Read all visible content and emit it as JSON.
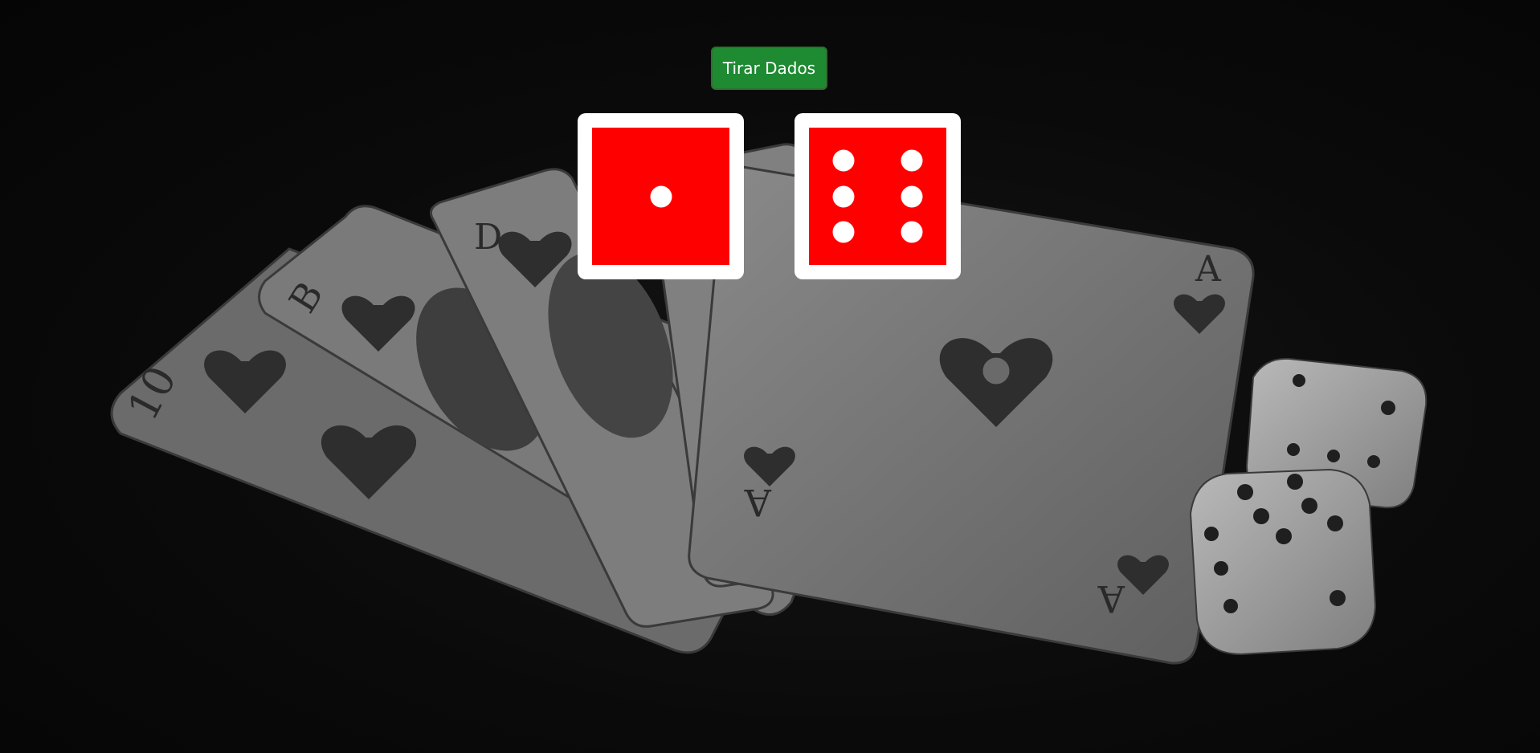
{
  "controls": {
    "roll_button_label": "Tirar Dados"
  },
  "dice": [
    {
      "value": 1,
      "face_color": "#ff0000",
      "border_color": "#ffffff",
      "pip_color": "#ffffff"
    },
    {
      "value": 6,
      "face_color": "#ff0000",
      "border_color": "#ffffff",
      "pip_color": "#ffffff"
    }
  ],
  "colors": {
    "button_green": "#1e8a32",
    "background": "#070707"
  },
  "background_art": {
    "card_corners": [
      "10",
      "B",
      "D",
      "A",
      "A",
      "A"
    ],
    "description_icons": [
      "playing-cards-icon",
      "white-dice-icon"
    ]
  }
}
